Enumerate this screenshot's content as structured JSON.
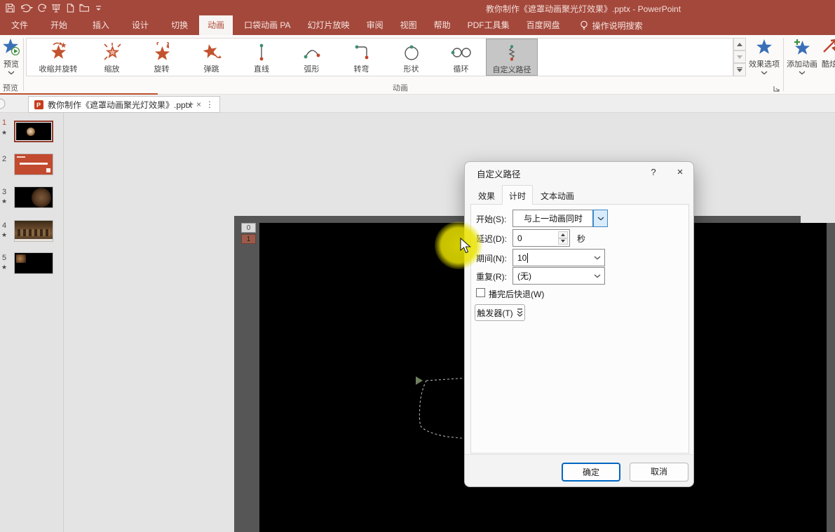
{
  "titlebar": {
    "title": "教你制作《遮罩动画聚光灯效果》.pptx  -  PowerPoint"
  },
  "ribbon": {
    "tabs": [
      {
        "label": "文件"
      },
      {
        "label": "开始"
      },
      {
        "label": "插入"
      },
      {
        "label": "设计"
      },
      {
        "label": "切换"
      },
      {
        "label": "动画"
      },
      {
        "label": "口袋动画 PA"
      },
      {
        "label": "幻灯片放映"
      },
      {
        "label": "审阅"
      },
      {
        "label": "视图"
      },
      {
        "label": "帮助"
      },
      {
        "label": "PDF工具集"
      },
      {
        "label": "百度网盘"
      }
    ],
    "search_label": "操作说明搜索",
    "preview_button_label": "预览",
    "preview_group_label": "预览",
    "animation_group_label": "动画",
    "gallery": [
      {
        "label": "收缩并旋转"
      },
      {
        "label": "缩放"
      },
      {
        "label": "旋转"
      },
      {
        "label": "弹跳"
      },
      {
        "label": "直线"
      },
      {
        "label": "弧形"
      },
      {
        "label": "转弯"
      },
      {
        "label": "形状"
      },
      {
        "label": "循环"
      },
      {
        "label": "自定义路径"
      }
    ],
    "effect_options_label": "效果选项",
    "add_animation_label": "添加动画",
    "cool_label": "酷炫"
  },
  "doc_tab": {
    "title": "教你制作《遮罩动画聚光灯效果》.pptx",
    "close": "×",
    "more": "⋮",
    "new_tab": "+"
  },
  "slides": {
    "star": "★",
    "items": [
      {
        "number": "1"
      },
      {
        "number": "2"
      },
      {
        "number": "3"
      },
      {
        "number": "4"
      },
      {
        "number": "5"
      }
    ]
  },
  "canvas": {
    "badge_zero": "0",
    "badge_one": "1"
  },
  "dialog": {
    "title": "自定义路径",
    "help": "?",
    "close": "×",
    "tabs": [
      {
        "label": "效果"
      },
      {
        "label": "计时"
      },
      {
        "label": "文本动画"
      }
    ],
    "start_label": "开始(S):",
    "start_value": "与上一动画同时",
    "delay_label": "延迟(D):",
    "delay_value": "0",
    "delay_unit": "秒",
    "duration_label": "期间(N):",
    "duration_value": "10",
    "repeat_label": "重复(R):",
    "repeat_value": "(无)",
    "rewind_label": "播完后快退(W)",
    "trigger_label": "触发器(T)",
    "ok_label": "确定",
    "cancel_label": "取消"
  }
}
